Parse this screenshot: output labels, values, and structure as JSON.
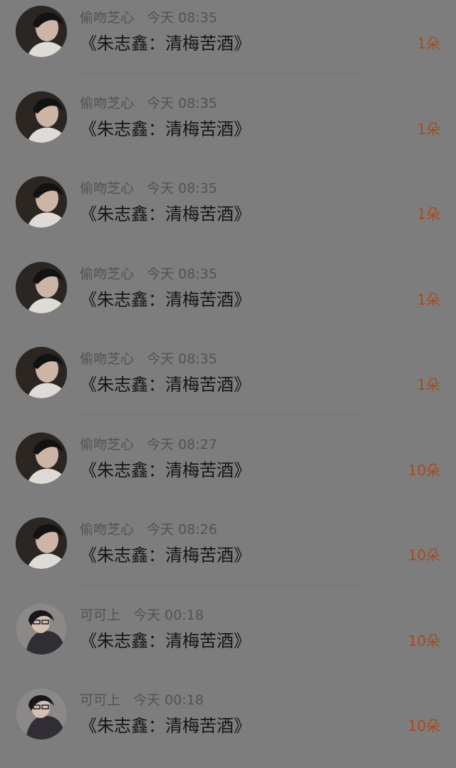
{
  "gifts": [
    {
      "user": "偷吻芝心",
      "time": "今天 08:35",
      "title": "《朱志鑫：清梅苦酒》",
      "count": "1朵",
      "avatar_icon": "avatar-boy-profile-icon"
    },
    {
      "user": "偷吻芝心",
      "time": "今天 08:35",
      "title": "《朱志鑫：清梅苦酒》",
      "count": "1朵",
      "avatar_icon": "avatar-boy-profile-icon"
    },
    {
      "user": "偷吻芝心",
      "time": "今天 08:35",
      "title": "《朱志鑫：清梅苦酒》",
      "count": "1朵",
      "avatar_icon": "avatar-boy-profile-icon"
    },
    {
      "user": "偷吻芝心",
      "time": "今天 08:35",
      "title": "《朱志鑫：清梅苦酒》",
      "count": "1朵",
      "avatar_icon": "avatar-boy-profile-icon"
    },
    {
      "user": "偷吻芝心",
      "time": "今天 08:35",
      "title": "《朱志鑫：清梅苦酒》",
      "count": "1朵",
      "avatar_icon": "avatar-boy-profile-icon"
    },
    {
      "user": "偷吻芝心",
      "time": "今天 08:27",
      "title": "《朱志鑫：清梅苦酒》",
      "count": "10朵",
      "avatar_icon": "avatar-boy-profile-icon"
    },
    {
      "user": "偷吻芝心",
      "time": "今天 08:26",
      "title": "《朱志鑫：清梅苦酒》",
      "count": "10朵",
      "avatar_icon": "avatar-boy-profile-icon"
    },
    {
      "user": "可可上",
      "time": "今天 00:18",
      "title": "《朱志鑫：清梅苦酒》",
      "count": "10朵",
      "avatar_icon": "avatar-boy-hoodie-icon"
    },
    {
      "user": "可可上",
      "time": "今天 00:18",
      "title": "《朱志鑫：清梅苦酒》",
      "count": "10朵",
      "avatar_icon": "avatar-boy-hoodie-icon"
    }
  ]
}
